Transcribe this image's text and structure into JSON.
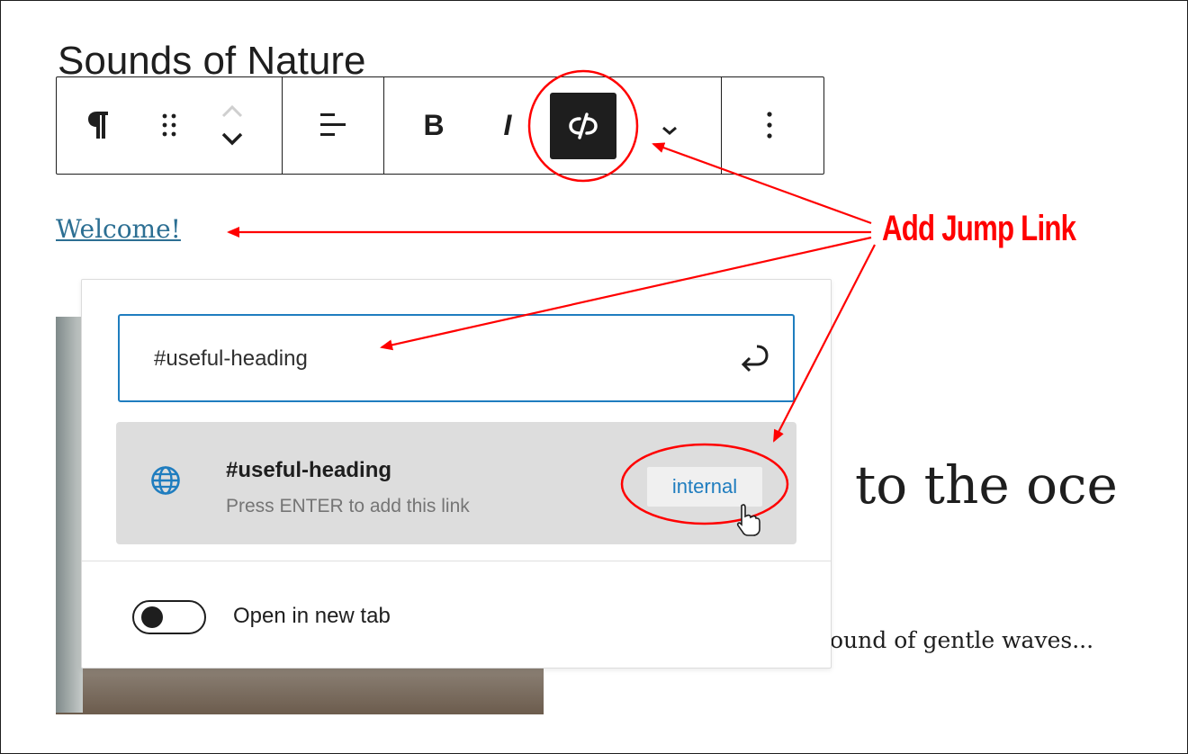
{
  "editor": {
    "post_title": "Sounds of Nature",
    "paragraph_link_text": "Welcome!",
    "heading_text": "to the oce",
    "paragraph_text": "ound of gentle waves..."
  },
  "toolbar": {
    "buttons": [
      {
        "name": "paragraph",
        "icon": "pilcrow-icon"
      },
      {
        "name": "drag",
        "icon": "drag-handle-icon"
      },
      {
        "name": "move",
        "icon": "chevron-up-down-icon"
      },
      {
        "name": "align",
        "icon": "align-left-icon"
      },
      {
        "name": "bold",
        "label": "B"
      },
      {
        "name": "italic",
        "label": "I"
      },
      {
        "name": "link",
        "icon": "unlink-icon",
        "active": true
      },
      {
        "name": "more-formatting",
        "icon": "chevron-down-icon"
      },
      {
        "name": "options",
        "icon": "more-vertical-icon"
      }
    ]
  },
  "link_popover": {
    "url_value": "#useful-heading",
    "suggestion": {
      "title": "#useful-heading",
      "subtitle": "Press ENTER to add this link",
      "badge": "internal",
      "icon": "globe-icon"
    },
    "toggle": {
      "label": "Open in new tab",
      "checked": false
    }
  },
  "annotation": {
    "label": "Add Jump Link",
    "color": "#ff0000"
  },
  "colors": {
    "accent": "#1f7dbf",
    "link": "#2c6f93",
    "dark": "#1e1e1e"
  }
}
